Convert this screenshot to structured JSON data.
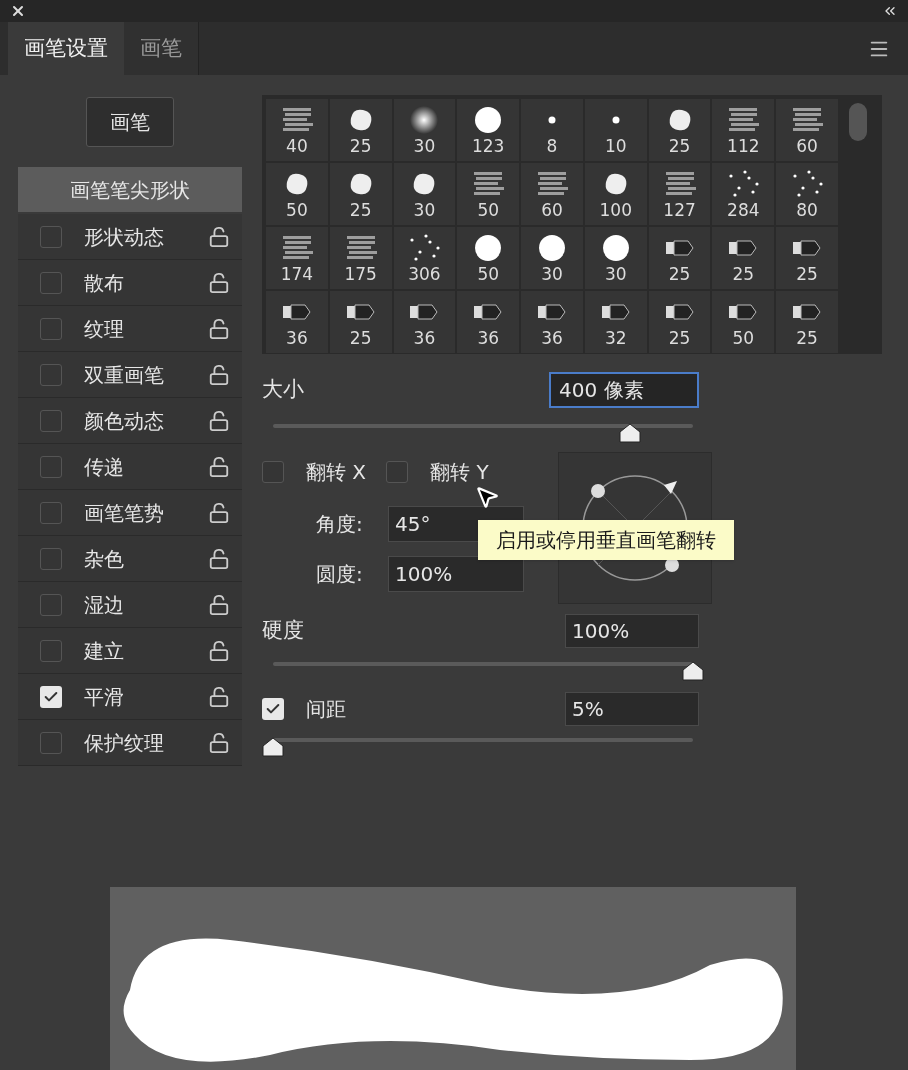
{
  "tabs": [
    {
      "label": "画笔设置",
      "selected": true
    },
    {
      "label": "画笔",
      "selected": false
    }
  ],
  "brush_button": "画笔",
  "tip_shape": {
    "label": "画笔笔尖形状",
    "selected": true
  },
  "options": [
    {
      "label": "形状动态",
      "checked": false,
      "selected": false
    },
    {
      "label": "散布",
      "checked": false,
      "selected": false
    },
    {
      "label": "纹理",
      "checked": false,
      "selected": false
    },
    {
      "label": "双重画笔",
      "checked": false,
      "selected": false
    },
    {
      "label": "颜色动态",
      "checked": false,
      "selected": false
    },
    {
      "label": "传递",
      "checked": false,
      "selected": false
    },
    {
      "label": "画笔笔势",
      "checked": false,
      "selected": false
    },
    {
      "label": "杂色",
      "checked": false,
      "selected": false
    },
    {
      "label": "湿边",
      "checked": false,
      "selected": false
    },
    {
      "label": "建立",
      "checked": false,
      "selected": false
    },
    {
      "label": "平滑",
      "checked": true,
      "selected": false
    },
    {
      "label": "保护纹理",
      "checked": false,
      "selected": false
    }
  ],
  "brush_tips": [
    {
      "size": "40",
      "kind": "texture"
    },
    {
      "size": "25",
      "kind": "blob"
    },
    {
      "size": "30",
      "kind": "soft"
    },
    {
      "size": "123",
      "kind": "hard"
    },
    {
      "size": "8",
      "kind": "dot"
    },
    {
      "size": "10",
      "kind": "dot"
    },
    {
      "size": "25",
      "kind": "blob"
    },
    {
      "size": "112",
      "kind": "texture"
    },
    {
      "size": "60",
      "kind": "texture"
    },
    {
      "size": "50",
      "kind": "blob"
    },
    {
      "size": "25",
      "kind": "blob"
    },
    {
      "size": "30",
      "kind": "blob"
    },
    {
      "size": "50",
      "kind": "texture"
    },
    {
      "size": "60",
      "kind": "texture"
    },
    {
      "size": "100",
      "kind": "blob"
    },
    {
      "size": "127",
      "kind": "texture"
    },
    {
      "size": "284",
      "kind": "scatter"
    },
    {
      "size": "80",
      "kind": "scatter"
    },
    {
      "size": "174",
      "kind": "texture"
    },
    {
      "size": "175",
      "kind": "texture"
    },
    {
      "size": "306",
      "kind": "scatter"
    },
    {
      "size": "50",
      "kind": "hard"
    },
    {
      "size": "30",
      "kind": "hard"
    },
    {
      "size": "30",
      "kind": "hard"
    },
    {
      "size": "25",
      "kind": "bristle"
    },
    {
      "size": "25",
      "kind": "bristle"
    },
    {
      "size": "25",
      "kind": "bristle"
    },
    {
      "size": "36",
      "kind": "bristle"
    },
    {
      "size": "25",
      "kind": "bristle"
    },
    {
      "size": "36",
      "kind": "bristle"
    },
    {
      "size": "36",
      "kind": "bristle"
    },
    {
      "size": "36",
      "kind": "bristle"
    },
    {
      "size": "32",
      "kind": "bristle"
    },
    {
      "size": "25",
      "kind": "bristle"
    },
    {
      "size": "50",
      "kind": "bristle"
    },
    {
      "size": "25",
      "kind": "bristle"
    }
  ],
  "size": {
    "label": "大小",
    "value": "400 像素",
    "focused": true,
    "level": 0.85
  },
  "flips": [
    {
      "label": "翻转 X",
      "checked": false
    },
    {
      "label": "翻转 Y",
      "checked": false
    }
  ],
  "angle": {
    "label": "角度:",
    "value": "45°"
  },
  "roundness": {
    "label": "圆度:",
    "value": "100%"
  },
  "tooltip": "启用或停用垂直画笔翻转",
  "hardness": {
    "label": "硬度",
    "value": "100%",
    "level": 1
  },
  "spacing": {
    "label": "间距",
    "value": "5%",
    "checked": true,
    "level": 0
  }
}
